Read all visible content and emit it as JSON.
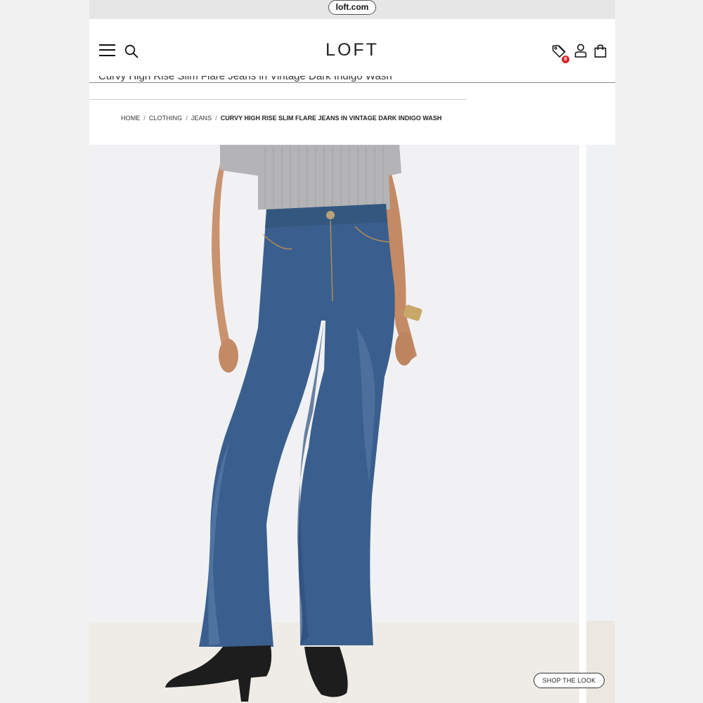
{
  "browser": {
    "url": "loft.com"
  },
  "header": {
    "logo": "LOFT",
    "menu_icon": "hamburger-menu-icon",
    "search_icon": "search-icon",
    "offers_icon": "price-tag-icon",
    "offers_badge": "8",
    "account_icon": "user-icon",
    "bag_icon": "shopping-bag-icon",
    "badge_color": "#d9272e"
  },
  "product": {
    "scrolled_title": "Curvy High Rise Slim Flare Jeans in Vintage Dark Indigo Wash"
  },
  "breadcrumb": [
    {
      "label": "HOME"
    },
    {
      "label": "CLOTHING"
    },
    {
      "label": "JEANS"
    },
    {
      "label": "CURVY HIGH RISE SLIM FLARE JEANS IN VINTAGE DARK INDIGO WASH"
    }
  ],
  "image": {
    "shop_the_look": "SHOP THE LOOK",
    "denim_color": "#3a5f8f",
    "top_color": "#b4b4b7"
  }
}
